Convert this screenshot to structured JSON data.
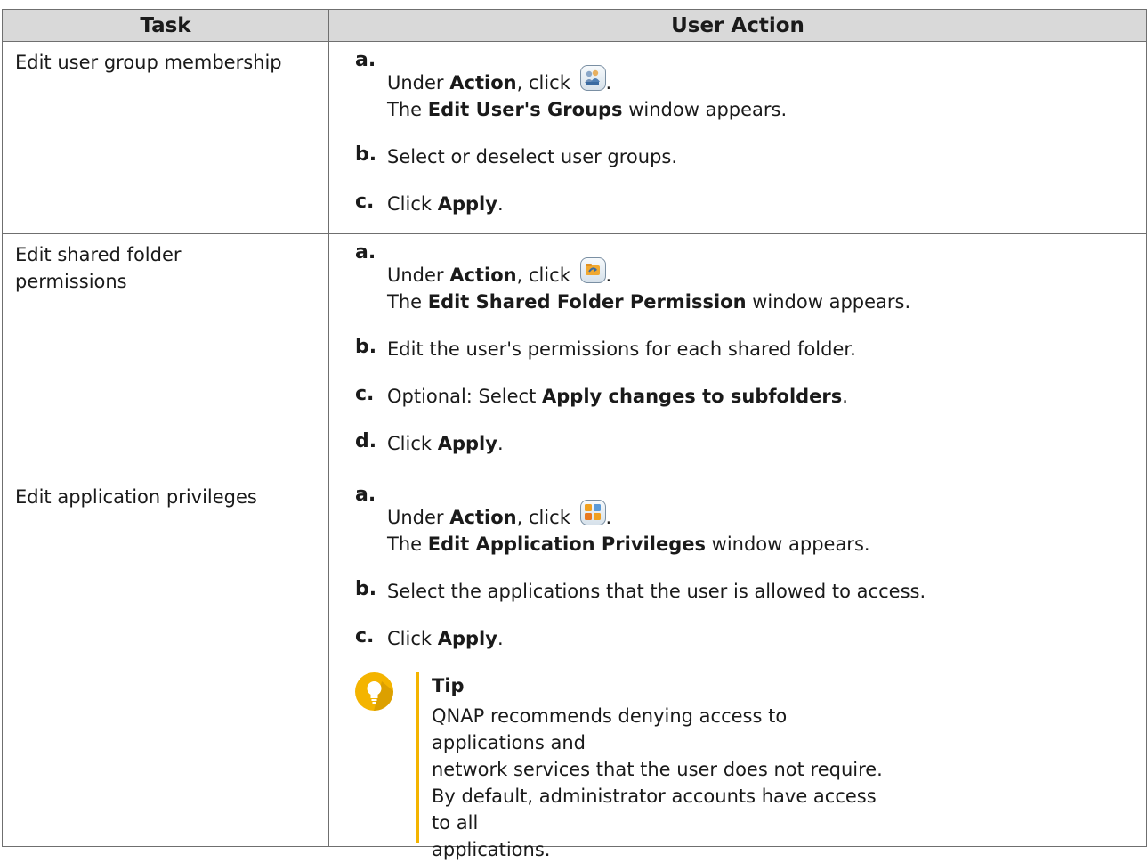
{
  "table": {
    "headers": {
      "task": "Task",
      "action": "User Action"
    },
    "rows": [
      {
        "task": "Edit user group membership",
        "steps": {
          "a": {
            "letter": "a.",
            "pre": "Under ",
            "bold": "Action",
            "mid": ", click ",
            "post": ".",
            "line2_pre": "The ",
            "line2_bold": "Edit User's Groups",
            "line2_post": " window appears.",
            "icon": "user-groups-icon"
          },
          "b": {
            "letter": "b.",
            "text": "Select or deselect user groups."
          },
          "c": {
            "letter": "c.",
            "pre": "Click ",
            "bold": "Apply",
            "post": "."
          }
        }
      },
      {
        "task": "Edit shared folder permissions",
        "steps": {
          "a": {
            "letter": "a.",
            "pre": "Under ",
            "bold": "Action",
            "mid": ", click ",
            "post": ".",
            "line2_pre": "The ",
            "line2_bold": "Edit Shared Folder Permission",
            "line2_post": " window appears.",
            "icon": "shared-folder-permission-icon"
          },
          "b": {
            "letter": "b.",
            "text": "Edit the user's permissions for each shared folder."
          },
          "c": {
            "letter": "c.",
            "pre": "Optional: Select ",
            "bold": "Apply changes to subfolders",
            "post": "."
          },
          "d": {
            "letter": "d.",
            "pre": "Click ",
            "bold": "Apply",
            "post": "."
          }
        }
      },
      {
        "task": "Edit application privileges",
        "steps": {
          "a": {
            "letter": "a.",
            "pre": "Under ",
            "bold": "Action",
            "mid": ", click ",
            "post": ".",
            "line2_pre": "The ",
            "line2_bold": "Edit Application Privileges",
            "line2_post": " window appears.",
            "icon": "application-privileges-icon"
          },
          "b": {
            "letter": "b.",
            "text": "Select the applications that the user is allowed to access."
          },
          "c": {
            "letter": "c.",
            "pre": "Click ",
            "bold": "Apply",
            "post": "."
          }
        },
        "tip": {
          "title": "Tip",
          "line1": "QNAP recommends denying access to applications and",
          "line2": "network services that the user does not require.",
          "line3": "By default, administrator accounts have access to all",
          "line4": "applications.",
          "icon": "lightbulb-icon"
        }
      }
    ]
  },
  "colors": {
    "header_bg": "#d9d9d9",
    "border": "#6f6f6f",
    "tip_accent": "#f4b400"
  }
}
